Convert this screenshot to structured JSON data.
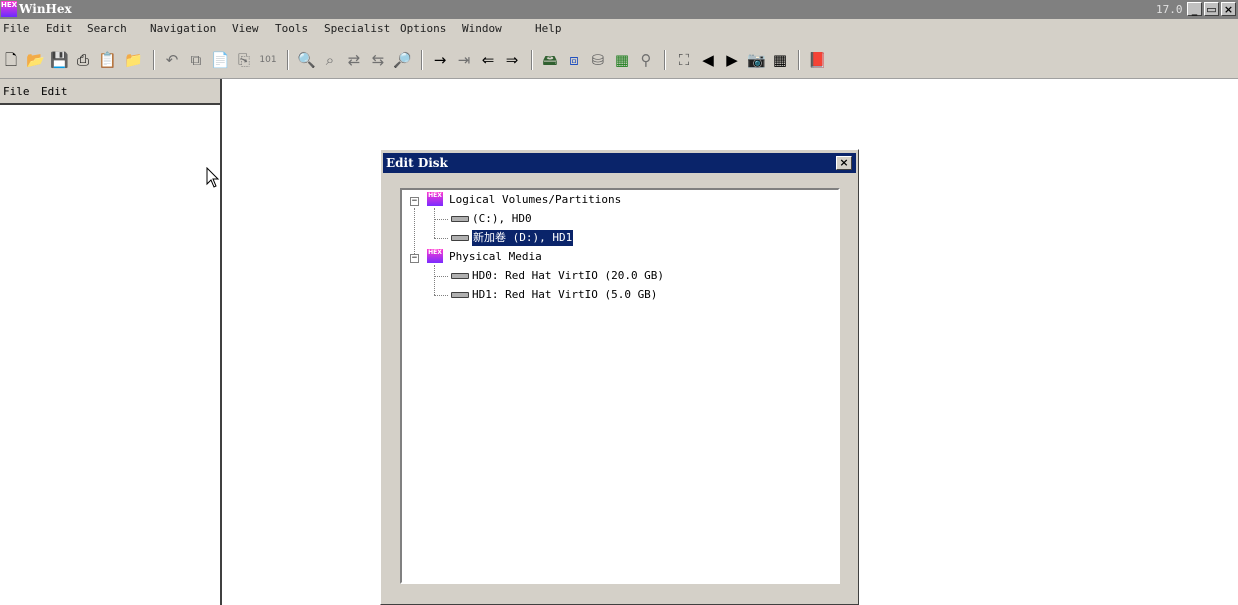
{
  "window": {
    "title": "WinHex",
    "version": "17.0",
    "min_label": "_",
    "max_label": "▭",
    "close_label": "×"
  },
  "menu": {
    "items": [
      "File",
      "Edit",
      "Search",
      "Navigation",
      "View",
      "Tools",
      "Specialist",
      "Options",
      "Window",
      "Help"
    ]
  },
  "left_pane": {
    "menu_file": "File",
    "menu_edit": "Edit"
  },
  "dialog": {
    "title": "Edit Disk",
    "close_label": "×",
    "tree": {
      "logical_group": "Logical Volumes/Partitions",
      "volume_c": "(C:), HD0",
      "volume_d": "新加卷 (D:), HD1",
      "physical_group": "Physical Media",
      "hd0": "HD0: Red Hat VirtIO (20.0 GB)",
      "hd1": "HD1: Red Hat VirtIO (5.0 GB)"
    }
  },
  "icons": {
    "app": "HEX",
    "expander": "−"
  }
}
